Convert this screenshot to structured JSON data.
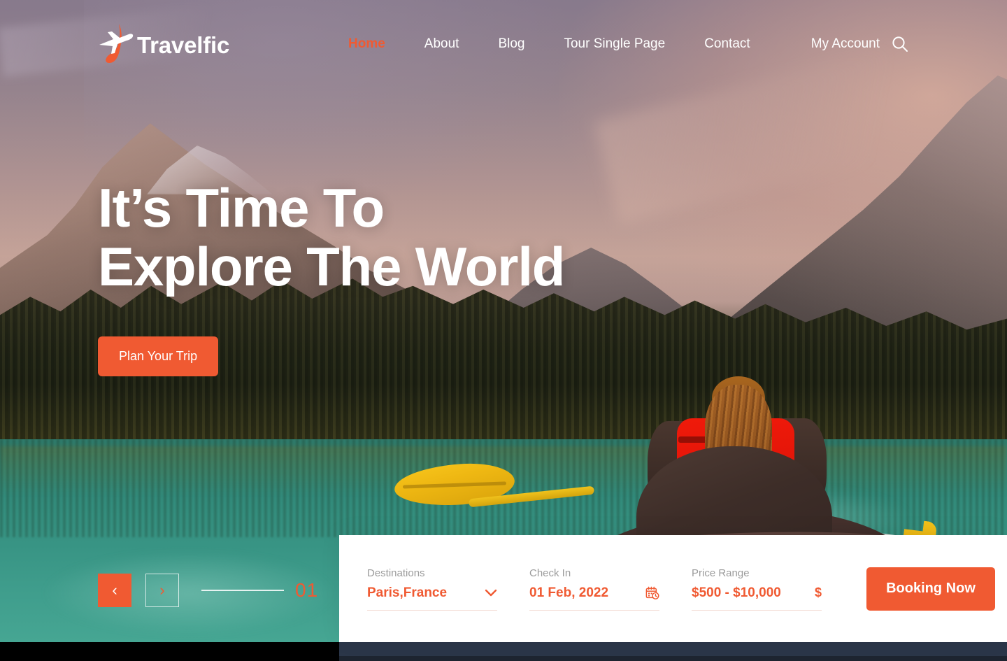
{
  "brand": {
    "name": "Travelfic",
    "logo_icon": "airplane-swoosh-icon",
    "accent_color": "#f05a32"
  },
  "header": {
    "nav": [
      {
        "label": "Home",
        "active": true
      },
      {
        "label": "About",
        "active": false
      },
      {
        "label": "Blog",
        "active": false
      },
      {
        "label": "Tour Single Page",
        "active": false
      },
      {
        "label": "Contact",
        "active": false
      }
    ],
    "account_label": "My Account",
    "search_icon": "search-icon"
  },
  "hero": {
    "title_line1": "It’s Time To",
    "title_line2": "Explore The World",
    "cta_label": "Plan Your Trip"
  },
  "slider": {
    "prev_icon": "‹",
    "next_icon": "›",
    "current": "01"
  },
  "booking": {
    "fields": [
      {
        "label": "Destinations",
        "value": "Paris,France",
        "icon": "chevron-down-icon"
      },
      {
        "label": "Check In",
        "value": "01 Feb, 2022",
        "icon": "calendar-clock-icon"
      },
      {
        "label": "Price Range",
        "value": "$500 - $10,000",
        "icon": "dollar-icon",
        "icon_glyph": "$"
      }
    ],
    "submit_label": "Booking Now"
  }
}
